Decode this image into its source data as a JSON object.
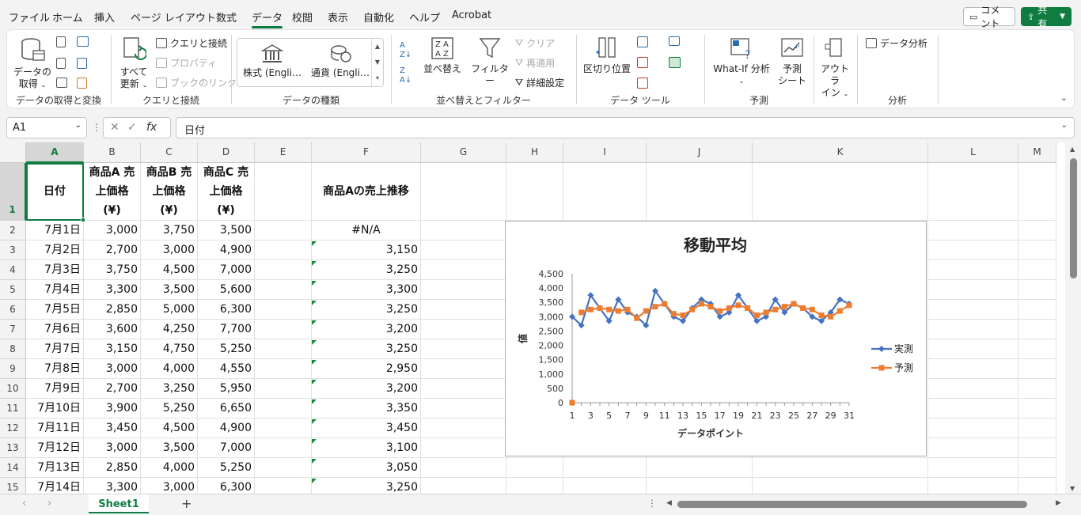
{
  "menu": {
    "tabs": [
      "ファイル",
      "ホーム",
      "挿入",
      "ページ レイアウト",
      "数式",
      "データ",
      "校閲",
      "表示",
      "自動化",
      "ヘルプ",
      "Acrobat"
    ],
    "active": "データ",
    "comment_label": "コメント",
    "share_label": "共有"
  },
  "ribbon": {
    "get_data": {
      "line1": "データの",
      "line2": "取得"
    },
    "refresh_all": {
      "line1": "すべて",
      "line2": "更新"
    },
    "queries_connections": "クエリと接続",
    "properties": "プロパティ",
    "edit_links": "ブックのリンク",
    "stocks": "株式 (Engli…",
    "currency": "通貨 (Engli…",
    "sort": "並べ替え",
    "filter": "フィルター",
    "clear": "クリア",
    "reapply": "再適用",
    "advanced": "詳細設定",
    "text_to_columns": "区切り位置",
    "whatif": "What-If 分析",
    "forecast": {
      "line1": "予測",
      "line2": "シート"
    },
    "outline": {
      "line1": "アウトラ",
      "line2": "イン"
    },
    "data_analysis": "データ分析",
    "groups": {
      "get_transform": "データの取得と変換",
      "queries": "クエリと接続",
      "data_types": "データの種類",
      "sort_filter": "並べ替えとフィルター",
      "data_tools": "データ ツール",
      "forecast": "予測",
      "analysis": "分析"
    }
  },
  "formula_bar": {
    "name_box": "A1",
    "fx": "fx",
    "value": "日付"
  },
  "columns": [
    "A",
    "B",
    "C",
    "D",
    "E",
    "F",
    "G",
    "H",
    "I",
    "J",
    "K",
    "L",
    "M"
  ],
  "header_row": {
    "A": "日付",
    "B": "商品A 売上価格 (¥)",
    "C": "商品B 売上価格 (¥)",
    "D": "商品C 売上価格 (¥)",
    "F": "商品Aの売上推移"
  },
  "rows": [
    {
      "n": "2",
      "date": "7月1日",
      "b": "3,000",
      "c": "3,750",
      "d": "3,500",
      "f": "#N/A"
    },
    {
      "n": "3",
      "date": "7月2日",
      "b": "2,700",
      "c": "3,000",
      "d": "4,900",
      "f": "3,150"
    },
    {
      "n": "4",
      "date": "7月3日",
      "b": "3,750",
      "c": "4,500",
      "d": "7,000",
      "f": "3,250"
    },
    {
      "n": "5",
      "date": "7月4日",
      "b": "3,300",
      "c": "3,500",
      "d": "5,600",
      "f": "3,300"
    },
    {
      "n": "6",
      "date": "7月5日",
      "b": "2,850",
      "c": "5,000",
      "d": "6,300",
      "f": "3,250"
    },
    {
      "n": "7",
      "date": "7月6日",
      "b": "3,600",
      "c": "4,250",
      "d": "7,700",
      "f": "3,200"
    },
    {
      "n": "8",
      "date": "7月7日",
      "b": "3,150",
      "c": "4,750",
      "d": "5,250",
      "f": "3,250"
    },
    {
      "n": "9",
      "date": "7月8日",
      "b": "3,000",
      "c": "4,000",
      "d": "4,550",
      "f": "2,950"
    },
    {
      "n": "10",
      "date": "7月9日",
      "b": "2,700",
      "c": "3,250",
      "d": "5,950",
      "f": "3,200"
    },
    {
      "n": "11",
      "date": "7月10日",
      "b": "3,900",
      "c": "5,250",
      "d": "6,650",
      "f": "3,350"
    },
    {
      "n": "12",
      "date": "7月11日",
      "b": "3,450",
      "c": "4,500",
      "d": "4,900",
      "f": "3,450"
    },
    {
      "n": "13",
      "date": "7月12日",
      "b": "3,000",
      "c": "3,500",
      "d": "7,000",
      "f": "3,100"
    },
    {
      "n": "14",
      "date": "7月13日",
      "b": "2,850",
      "c": "4,000",
      "d": "5,250",
      "f": "3,050"
    },
    {
      "n": "15",
      "date": "7月14日",
      "b": "3,300",
      "c": "3,000",
      "d": "6,300",
      "f": "3,250"
    }
  ],
  "chart_data": {
    "type": "line",
    "title": "移動平均",
    "xlabel": "データポイント",
    "ylabel": "値",
    "ylim": [
      0,
      4500
    ],
    "yticks": [
      "0",
      "500",
      "1,000",
      "1,500",
      "2,000",
      "2,500",
      "3,000",
      "3,500",
      "4,000",
      "4,500"
    ],
    "xticks": [
      "1",
      "3",
      "5",
      "7",
      "9",
      "11",
      "13",
      "15",
      "17",
      "19",
      "21",
      "23",
      "25",
      "27",
      "29",
      "31"
    ],
    "legend_position": "right",
    "series": [
      {
        "name": "実測",
        "color": "#4472c4",
        "marker": "diamond",
        "values": [
          3000,
          2700,
          3750,
          3300,
          2850,
          3600,
          3150,
          3000,
          2700,
          3900,
          3450,
          3000,
          2850,
          3300,
          3600,
          3450,
          3000,
          3150,
          3750,
          3300,
          2850,
          3000,
          3600,
          3150,
          3450,
          3300,
          3000,
          2850,
          3150,
          3600,
          3450
        ]
      },
      {
        "name": "予測",
        "color": "#ed7d31",
        "marker": "square",
        "values": [
          0,
          3150,
          3250,
          3300,
          3250,
          3200,
          3250,
          2950,
          3200,
          3350,
          3450,
          3100,
          3050,
          3250,
          3450,
          3350,
          3200,
          3300,
          3400,
          3300,
          3050,
          3150,
          3250,
          3350,
          3450,
          3300,
          3250,
          3050,
          3000,
          3200,
          3400
        ]
      }
    ]
  },
  "sheet": {
    "tab": "Sheet1",
    "add": "+"
  }
}
